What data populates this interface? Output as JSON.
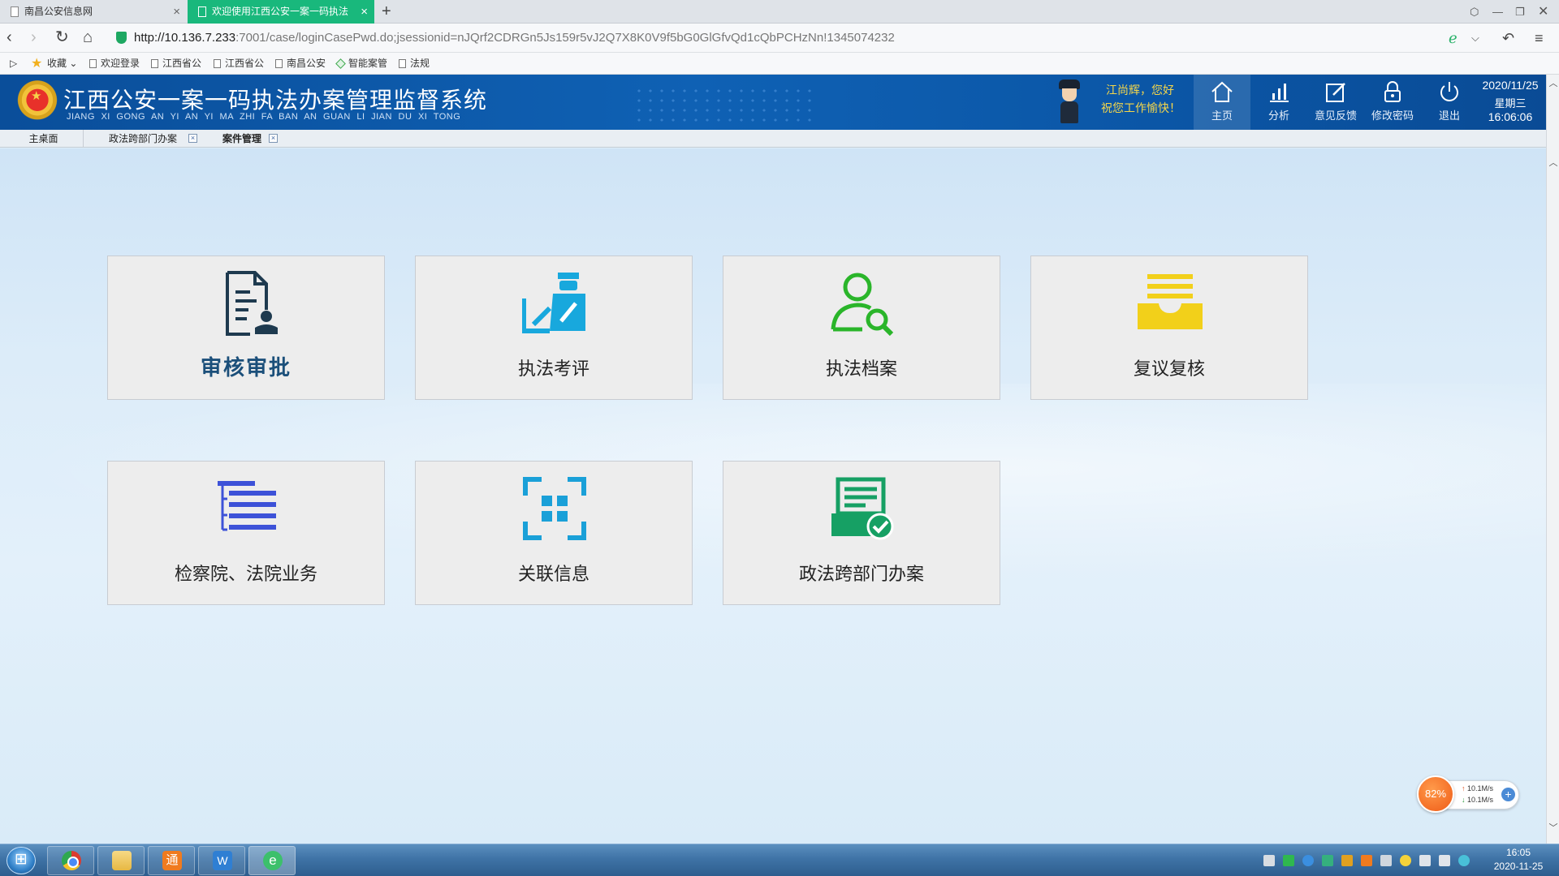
{
  "browser": {
    "tabs": [
      {
        "title": "南昌公安信息网",
        "active": false
      },
      {
        "title": "欢迎使用江西公安一案一码执法",
        "active": true
      }
    ],
    "url_host": "http://10.136.7.233",
    "url_path": ":7001/case/loginCasePwd.do;jsessionid=nJQrf2CDRGn5Js159r5vJ2Q7X8K0V9f5bG0GlGfvQd1cQbPCHzNn!1345074232",
    "bookmarks": [
      {
        "label": "收藏",
        "icon": "star-icon"
      },
      {
        "label": "欢迎登录",
        "icon": "page-icon"
      },
      {
        "label": "江西省公",
        "icon": "page-icon"
      },
      {
        "label": "江西省公",
        "icon": "page-icon"
      },
      {
        "label": "南昌公安",
        "icon": "page-icon"
      },
      {
        "label": "智能案管",
        "icon": "app-icon"
      },
      {
        "label": "法规",
        "icon": "page-icon"
      }
    ]
  },
  "header": {
    "title": "江西公安一案一码执法办案管理监督系统",
    "pinyin": "JIANG XI GONG AN YI AN YI MA ZHI FA BAN AN GUAN LI JIAN DU XI TONG",
    "greeting_line1": "江尚辉，您好",
    "greeting_line2": "祝您工作愉快！",
    "nav": [
      {
        "label": "主页",
        "icon": "home-icon",
        "active": true
      },
      {
        "label": "分析",
        "icon": "bar-chart-icon",
        "active": false
      },
      {
        "label": "意见反馈",
        "icon": "edit-icon",
        "active": false
      },
      {
        "label": "修改密码",
        "icon": "lock-icon",
        "active": false
      },
      {
        "label": "退出",
        "icon": "power-icon",
        "active": false
      }
    ],
    "date": "2020/11/25",
    "weekday": "星期三",
    "time": "16:06:06"
  },
  "app_tabs": [
    {
      "label": "主桌面",
      "closable": false
    },
    {
      "label": "政法跨部门办案",
      "closable": true
    },
    {
      "label": "案件管理",
      "closable": true,
      "active": true
    }
  ],
  "tiles": [
    {
      "label": "审核审批",
      "icon": "document-approval-icon",
      "color": "#1e3a4f"
    },
    {
      "label": "执法考评",
      "icon": "officer-evaluation-icon",
      "color": "#18a8dd"
    },
    {
      "label": "执法档案",
      "icon": "person-search-icon",
      "color": "#2ab52a"
    },
    {
      "label": "复议复核",
      "icon": "inbox-tray-icon",
      "color": "#f2d01a"
    },
    {
      "label": "检察院、法院业务",
      "icon": "list-tree-icon",
      "color": "#3d52d8"
    },
    {
      "label": "关联信息",
      "icon": "scan-grid-icon",
      "color": "#1aa0d8"
    },
    {
      "label": "政法跨部门办案",
      "icon": "verified-message-icon",
      "color": "#16a064"
    }
  ],
  "net_widget": {
    "percent": "82%",
    "up": "10.1M/s",
    "down": "10.1M/s"
  },
  "taskbar": {
    "apps": [
      {
        "name": "chrome",
        "icon": "chrome-icon"
      },
      {
        "name": "files",
        "icon": "folder-icon"
      },
      {
        "name": "tong",
        "icon": "tong-icon",
        "glyph": "通"
      },
      {
        "name": "work",
        "icon": "work-app-icon",
        "glyph": "W"
      },
      {
        "name": "browser",
        "icon": "ie-browser-icon",
        "glyph": "e"
      }
    ],
    "clock_time": "16:05",
    "clock_date": "2020-11-25"
  }
}
